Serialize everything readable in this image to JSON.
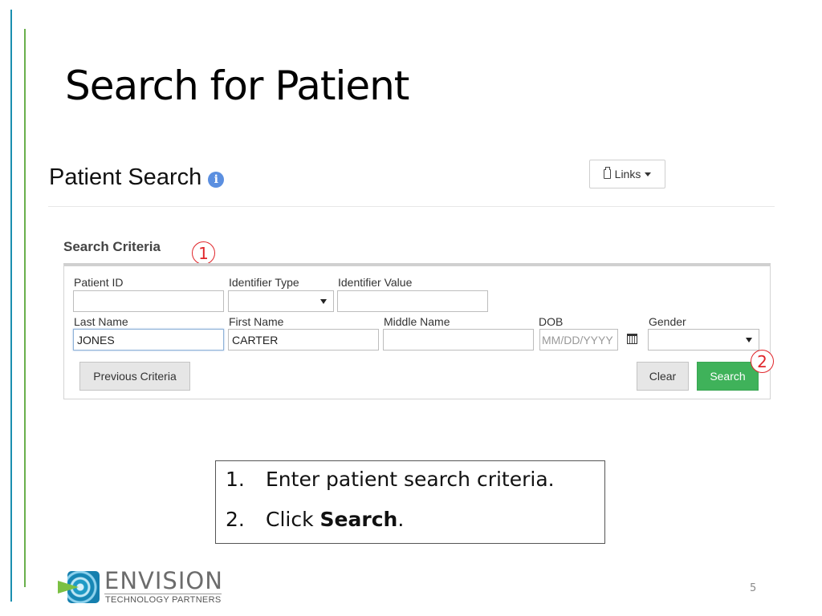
{
  "slide": {
    "title": "Search for Patient",
    "page_number": "5",
    "accent_colors": {
      "blue_bar": "#1a8fb0",
      "green_bar": "#6ab04c"
    }
  },
  "app": {
    "page_heading": "Patient Search",
    "info_icon": "info-icon",
    "links_button": {
      "label": "Links",
      "icon": "clipboard-icon"
    },
    "criteria_title": "Search Criteria",
    "fields": {
      "patient_id": {
        "label": "Patient ID",
        "value": ""
      },
      "identifier_type": {
        "label": "Identifier Type",
        "value": ""
      },
      "identifier_value": {
        "label": "Identifier Value",
        "value": ""
      },
      "last_name": {
        "label": "Last Name",
        "value": "JONES"
      },
      "first_name": {
        "label": "First Name",
        "value": "CARTER"
      },
      "middle_name": {
        "label": "Middle Name",
        "value": ""
      },
      "dob": {
        "label": "DOB",
        "value": "",
        "placeholder": "MM/DD/YYYY"
      },
      "gender": {
        "label": "Gender",
        "value": ""
      }
    },
    "buttons": {
      "previous_criteria": "Previous Criteria",
      "clear": "Clear",
      "search": "Search"
    },
    "button_colors": {
      "search": "#3fb25a",
      "default": "#e6e6e6"
    }
  },
  "annotations": {
    "step1": "1",
    "step2": "2",
    "color": "#e0262b"
  },
  "instructions": [
    {
      "num": "1.",
      "text": "Enter patient search criteria."
    },
    {
      "num": "2.",
      "prefix": "Click ",
      "bold": "Search",
      "suffix": "."
    }
  ],
  "logo": {
    "name": "ENVISION",
    "tagline": "TECHNOLOGY PARTNERS"
  }
}
